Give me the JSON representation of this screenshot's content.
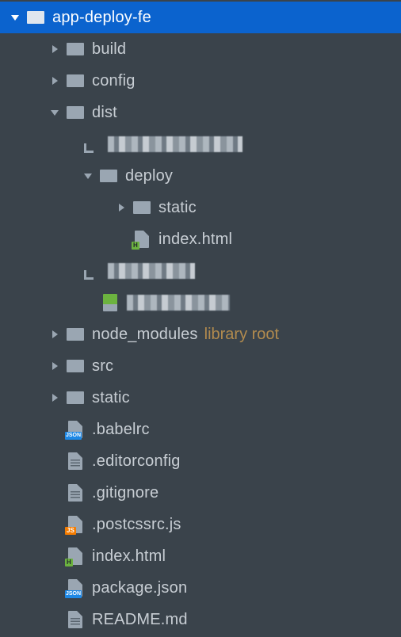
{
  "tree": {
    "root": {
      "name": "app-deploy-fe"
    },
    "items": [
      {
        "name": "build"
      },
      {
        "name": "config"
      },
      {
        "name": "dist"
      },
      {
        "name": "deploy"
      },
      {
        "name": "static"
      },
      {
        "name": "index.html"
      },
      {
        "name": "node_modules",
        "suffix": "library root"
      },
      {
        "name": "src"
      },
      {
        "name": "static"
      },
      {
        "name": ".babelrc"
      },
      {
        "name": ".editorconfig"
      },
      {
        "name": ".gitignore"
      },
      {
        "name": ".postcssrc.js"
      },
      {
        "name": "index.html"
      },
      {
        "name": "package.json"
      },
      {
        "name": "README.md"
      }
    ]
  },
  "colors": {
    "selection": "#0b63ce",
    "background": "#3a434b",
    "text": "#c8ced4",
    "suffix": "#b28b4e"
  }
}
